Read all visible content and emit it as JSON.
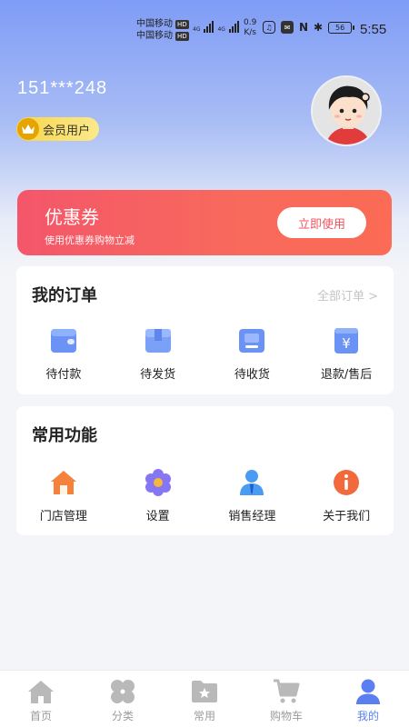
{
  "status_bar": {
    "carrier1": "中国移动",
    "carrier2": "中国移动",
    "hd": "HD",
    "net1": "4G",
    "net2": "4G",
    "speed_value": "0.9",
    "speed_unit": "K/s",
    "battery": "56",
    "time": "5:55"
  },
  "profile": {
    "phone": "151***248",
    "member_label": "会员用户"
  },
  "coupon": {
    "title": "优惠券",
    "description": "使用优惠券购物立减",
    "button_label": "立即使用"
  },
  "orders": {
    "title": "我的订单",
    "all_link": "全部订单 >",
    "items": [
      {
        "label": "待付款",
        "icon": "wallet-icon"
      },
      {
        "label": "待发货",
        "icon": "box-icon"
      },
      {
        "label": "待收货",
        "icon": "receive-tray-icon"
      },
      {
        "label": "退款/售后",
        "icon": "yen-refund-icon"
      }
    ]
  },
  "functions": {
    "title": "常用功能",
    "items": [
      {
        "label": "门店管理",
        "icon": "store-house-icon"
      },
      {
        "label": "设置",
        "icon": "gear-icon"
      },
      {
        "label": "销售经理",
        "icon": "manager-icon"
      },
      {
        "label": "关于我们",
        "icon": "info-icon"
      }
    ]
  },
  "tabs": [
    {
      "label": "首页",
      "icon": "home-icon",
      "active": false
    },
    {
      "label": "分类",
      "icon": "category-icon",
      "active": false
    },
    {
      "label": "常用",
      "icon": "star-folder-icon",
      "active": false
    },
    {
      "label": "购物车",
      "icon": "cart-icon",
      "active": false
    },
    {
      "label": "我的",
      "icon": "profile-icon",
      "active": true
    }
  ],
  "colors": {
    "accent": "#5b7ff0",
    "coupon": "#f4566a",
    "member_gold": "#f8d64a",
    "icon_blue": "#6b93f5",
    "icon_orange": "#f4823c"
  }
}
